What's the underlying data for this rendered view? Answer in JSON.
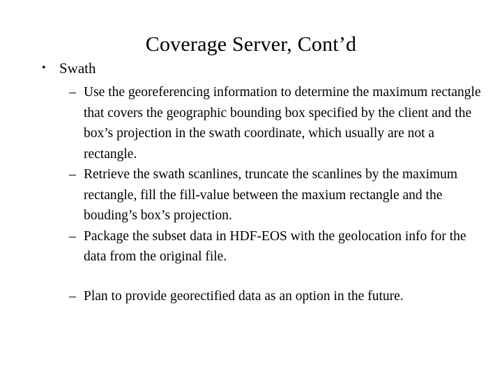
{
  "slide": {
    "title": "Coverage Server, Cont’d",
    "background_color": "#ffffff",
    "text_color": "#000000",
    "bullets": [
      {
        "level": 1,
        "marker": "•",
        "text": "Swath"
      },
      {
        "level": 2,
        "marker": "–",
        "text": "Use the georeferencing information to determine the maximum rectangle that covers the geographic bounding box specified by the client and the box’s projection in the swath coordinate, which usually are not a rectangle.",
        "spaced_before": false
      },
      {
        "level": 2,
        "marker": "–",
        "text": "Retrieve the swath scanlines, truncate the scanlines by the maximum rectangle, fill the fill-value between the maxium rectangle and the bouding’s box’s projection.",
        "spaced_before": false
      },
      {
        "level": 2,
        "marker": "–",
        "text": "Package the subset data in HDF-EOS with the geolocation info for the data from the original file.",
        "spaced_before": false
      },
      {
        "level": 2,
        "marker": "–",
        "text": "Plan to provide georectified data as an option in the future.",
        "spaced_before": true
      }
    ]
  }
}
